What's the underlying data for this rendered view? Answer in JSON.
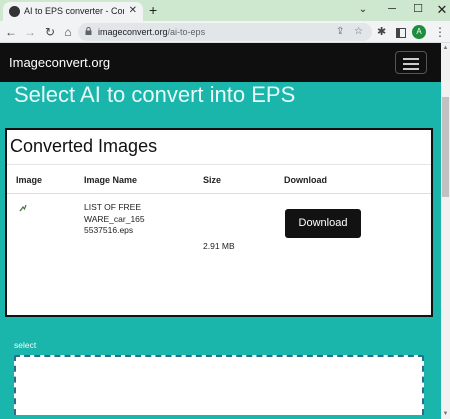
{
  "browser": {
    "tab_title": "AI to EPS converter - Convert AI",
    "tab_close": "✕",
    "new_tab": "+",
    "url_domain": "imageconvert.org",
    "url_path": "/ai-to-eps",
    "profile_initial": "A"
  },
  "site": {
    "brand": "Imageconvert.org",
    "heading": "Select AI to convert into EPS"
  },
  "results": {
    "title": "Converted Images",
    "columns": [
      "Image",
      "Image Name",
      "Size",
      "Download"
    ],
    "rows": [
      {
        "image_icon": "broken-image-icon",
        "name": "LIST OF FREEWARE_car_1655537516.eps",
        "size": "2.91 MB",
        "download_label": "Download"
      }
    ]
  },
  "upload": {
    "label": "select"
  },
  "colors": {
    "page_background": "#1ab5ab",
    "header_background": "#0f0f10",
    "button_background": "#121212",
    "tabstrip_background": "#cde8ce"
  }
}
